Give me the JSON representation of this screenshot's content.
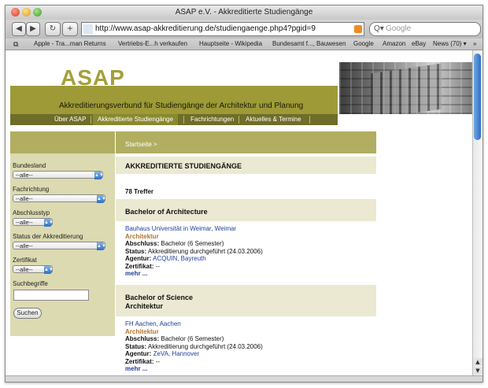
{
  "window": {
    "title": "ASAP e.V. - Akkreditierte Studiengänge"
  },
  "toolbar": {
    "back": "◀",
    "forward": "▶",
    "reload": "↻",
    "add": "+",
    "url": "http://www.asap-akkreditierung.de/studiengaenge.php4?pgid=9",
    "search_placeholder": "Google",
    "search_icon": "magnifier-icon"
  },
  "bookmarks": [
    "Apple - Tra...man Returns",
    "Vertriebs-E...h verkaufen",
    "Hauptseite - Wikipedia",
    "Bundesamt f..., Bauwesen",
    "Google",
    "Amazon",
    "eBay",
    "News (70) ▾",
    "»"
  ],
  "header": {
    "logo": "ASAP",
    "tagline": "Akkreditierungsverbund für Studiengänge der Architektur und Planung"
  },
  "nav": [
    {
      "label": "Über ASAP"
    },
    {
      "label": "Akkreditierte Studiengänge"
    },
    {
      "label": "Fachrichtungen"
    },
    {
      "label": "Aktuelles & Termine"
    }
  ],
  "sidebar": {
    "filters": [
      {
        "label": "Bundesland",
        "value": "--alle--"
      },
      {
        "label": "Fachrichtung",
        "value": "--alle--"
      },
      {
        "label": "Abschlusstyp",
        "value": "--alle--"
      },
      {
        "label": "Status der Akkreditierung",
        "value": "--alle--"
      },
      {
        "label": "Zertifikat",
        "value": "--alle--"
      }
    ],
    "search_label": "Suchbegriffe",
    "search_value": "",
    "submit": "Suchen"
  },
  "content": {
    "breadcrumb": "Startseite >",
    "heading": "AKKREDITIERTE STUDIENGÄNGE",
    "count": "78 Treffer",
    "groups": [
      {
        "title_line1": "Bachelor of Architecture",
        "title_line2": "",
        "entry": {
          "institution": "Bauhaus Universität in Weimar, Weimar",
          "subject": "Architektur",
          "abschluss_label": "Abschluss:",
          "abschluss": "Bachelor (6 Semester)",
          "status_label": "Status:",
          "status": "Akkreditierung durchgeführt (24.03.2006)",
          "agentur_label": "Agentur:",
          "agentur": "ACQUIN, Bayreuth",
          "zertifikat_label": "Zertifikat:",
          "zertifikat": "--",
          "more": "mehr ..."
        }
      },
      {
        "title_line1": "Bachelor of Science",
        "title_line2": "Architektur",
        "entry": {
          "institution": "FH Aachen, Aachen",
          "subject": "Architektur",
          "abschluss_label": "Abschluss:",
          "abschluss": "Bachelor (6 Semester)",
          "status_label": "Status:",
          "status": "Akkreditierung durchgeführt (24.03.2006)",
          "agentur_label": "Agentur:",
          "agentur": "ZeVA, Hannover",
          "zertifikat_label": "Zertifikat:",
          "zertifikat": "--",
          "more": "mehr ..."
        }
      }
    ]
  },
  "colors": {
    "olive": "#9d9a37",
    "olive_dark": "#6f6d28",
    "sand": "#dcdab0",
    "band": "#ebe9d2",
    "link": "#1f3e9a",
    "subject": "#b8712a"
  }
}
